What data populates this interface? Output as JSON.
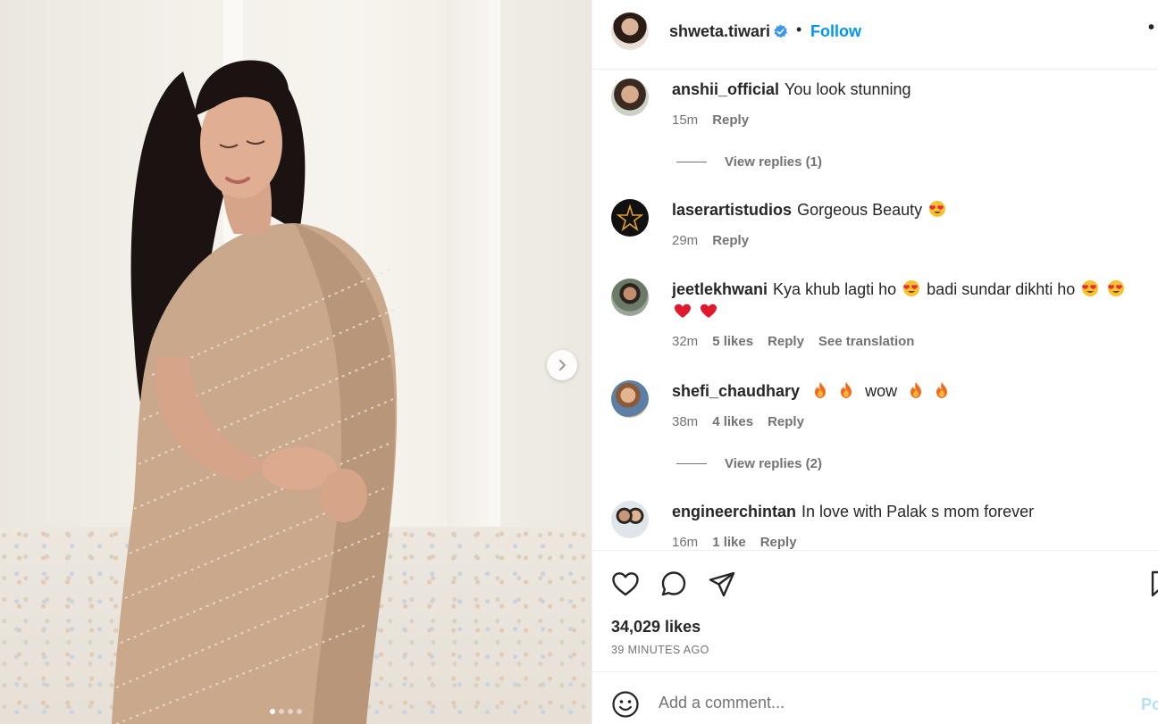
{
  "header": {
    "username": "shweta.tiwari",
    "separator": "•",
    "follow_label": "Follow",
    "more_label": "•"
  },
  "comments": [
    {
      "username": "anshii_official",
      "text": "You look stunning",
      "time": "15m",
      "likes": "",
      "reply_label": "Reply",
      "translate_label": "",
      "view_replies": "View replies (1)"
    },
    {
      "username": "laserartistudios",
      "text": "Gorgeous Beauty",
      "emojis": [
        "heart-eyes"
      ],
      "time": "29m",
      "likes": "",
      "reply_label": "Reply",
      "translate_label": "",
      "view_replies": ""
    },
    {
      "username": "jeetlekhwani",
      "text_part1": "Kya khub lagti ho",
      "text_part2": "badi sundar dikhti ho",
      "time": "32m",
      "likes": "5 likes",
      "reply_label": "Reply",
      "translate_label": "See translation",
      "view_replies": ""
    },
    {
      "username": "shefi_chaudhary",
      "text": "wow",
      "time": "38m",
      "likes": "4 likes",
      "reply_label": "Reply",
      "translate_label": "",
      "view_replies": "View replies (2)"
    },
    {
      "username": "engineerchintan",
      "text": "In love with Palak s mom forever",
      "time": "16m",
      "likes": "1 like",
      "reply_label": "Reply",
      "translate_label": "",
      "view_replies": ""
    }
  ],
  "engagement": {
    "likes": "34,029 likes",
    "time_ago": "39 MINUTES AGO"
  },
  "composer": {
    "placeholder": "Add a comment...",
    "post_label": "Po"
  },
  "icons": {
    "like": "heart-icon",
    "comment": "comment-icon",
    "share": "share-icon",
    "save": "bookmark-icon",
    "emoji": "smile-icon",
    "next": "chevron-right-icon"
  },
  "colors": {
    "accent": "#0095f6",
    "text": "#262626",
    "muted": "#737373",
    "verified": "#3897f0"
  }
}
